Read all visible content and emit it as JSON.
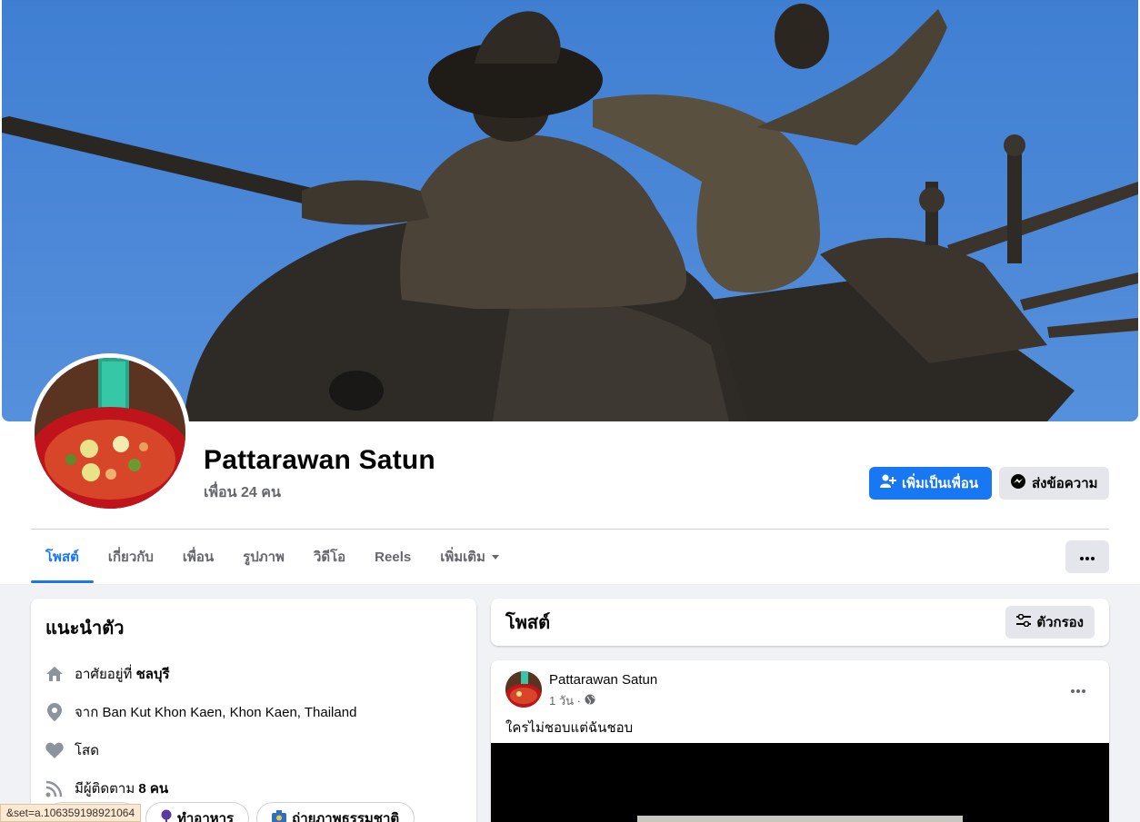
{
  "profile": {
    "name": "Pattarawan Satun",
    "friends_count": "เพื่อน 24 คน"
  },
  "actions": {
    "add_friend": "เพิ่มเป็นเพื่อน",
    "message": "ส่งข้อความ"
  },
  "tabs": [
    {
      "label": "โพสต์",
      "active": true
    },
    {
      "label": "เกี่ยวกับ"
    },
    {
      "label": "เพื่อน"
    },
    {
      "label": "รูปภาพ"
    },
    {
      "label": "วิดีโอ"
    },
    {
      "label": "Reels"
    },
    {
      "label": "เพิ่มเติม"
    }
  ],
  "intro": {
    "title": "แนะนำตัว",
    "lives_prefix": "อาศัยอยู่ที่ ",
    "lives_place": "ชลบุรี",
    "from_prefix": "จาก ",
    "from_place": "Ban Kut Khon Kaen, Khon Kaen, Thailand",
    "relationship": "โสด",
    "followers_prefix": "มีผู้ติดตาม ",
    "followers_count": "8 คน",
    "chips": [
      "ทำอาหาร",
      "ถ่ายภาพธรรมชาติ"
    ]
  },
  "posts_section": {
    "title": "โพสต์",
    "filter_label": "ตัวกรอง"
  },
  "post": {
    "author": "Pattarawan Satun",
    "time": "1 วัน ·",
    "text": "ใครไม่ชอบแต่ฉันชอบ"
  },
  "status_bar": "&set=a.106359198921064",
  "colors": {
    "brand_blue": "#1877f2",
    "page_bg": "#f0f2f5",
    "button_gray": "#e4e6eb",
    "secondary_text": "#65676b"
  }
}
